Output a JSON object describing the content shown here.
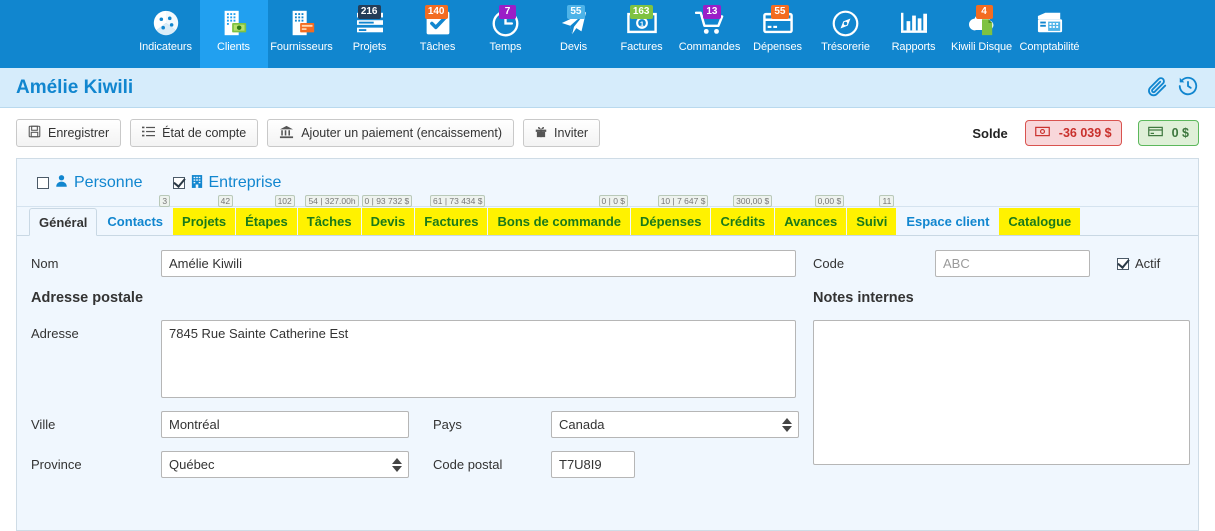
{
  "nav": {
    "items": [
      {
        "label": "Indicateurs",
        "icon": "dashboard-icon",
        "badge": null,
        "badge_color": null,
        "active": false
      },
      {
        "label": "Clients",
        "icon": "clients-icon",
        "badge": null,
        "badge_color": null,
        "active": true
      },
      {
        "label": "Fournisseurs",
        "icon": "suppliers-icon",
        "badge": null,
        "badge_color": null,
        "active": false
      },
      {
        "label": "Projets",
        "icon": "projects-icon",
        "badge": "216",
        "badge_color": "#243d58",
        "active": false
      },
      {
        "label": "Tâches",
        "icon": "tasks-icon",
        "badge": "140",
        "badge_color": "#f36c21",
        "active": false
      },
      {
        "label": "Temps",
        "icon": "time-icon",
        "badge": "7",
        "badge_color": "#9b1ec7",
        "active": false
      },
      {
        "label": "Devis",
        "icon": "quotes-icon",
        "badge": "55",
        "badge_color": "#4eb3e8",
        "active": false
      },
      {
        "label": "Factures",
        "icon": "invoices-icon",
        "badge": "163",
        "badge_color": "#7fc241",
        "active": false
      },
      {
        "label": "Commandes",
        "icon": "orders-icon",
        "badge": "13",
        "badge_color": "#9b1ec7",
        "active": false
      },
      {
        "label": "Dépenses",
        "icon": "expenses-icon",
        "badge": "55",
        "badge_color": "#f36c21",
        "active": false
      },
      {
        "label": "Trésorerie",
        "icon": "treasury-icon",
        "badge": null,
        "badge_color": null,
        "active": false
      },
      {
        "label": "Rapports",
        "icon": "reports-icon",
        "badge": null,
        "badge_color": null,
        "active": false
      },
      {
        "label": "Kiwili Disque",
        "icon": "cloud-disk-icon",
        "badge": "4",
        "badge_color": "#f36c21",
        "active": false
      },
      {
        "label": "Comptabilité",
        "icon": "accounting-icon",
        "badge": null,
        "badge_color": null,
        "active": false
      }
    ]
  },
  "titlebar": {
    "title": "Amélie Kiwili"
  },
  "toolbar": {
    "save_label": "Enregistrer",
    "statement_label": "État de compte",
    "payment_label": "Ajouter un paiement (encaissement)",
    "invite_label": "Inviter",
    "solde_label": "Solde",
    "solde_negative": "-36 039 $",
    "solde_positive": "0 $"
  },
  "type_row": {
    "personne_label": "Personne",
    "personne_checked": false,
    "entreprise_label": "Entreprise",
    "entreprise_checked": true
  },
  "tabs": [
    {
      "label": "Général",
      "badge": null,
      "style": "general"
    },
    {
      "label": "Contacts",
      "badge": "3",
      "style": "plain"
    },
    {
      "label": "Projets",
      "badge": "42",
      "style": "hl"
    },
    {
      "label": "Étapes",
      "badge": "102",
      "style": "hl"
    },
    {
      "label": "Tâches",
      "badge": "54 | 327.00h",
      "style": "hl"
    },
    {
      "label": "Devis",
      "badge": "0 | 93 732 $",
      "style": "hl"
    },
    {
      "label": "Factures",
      "badge": "61 | 73 434 $",
      "style": "hl"
    },
    {
      "label": "Bons de commande",
      "badge": "0 | 0 $",
      "style": "hl"
    },
    {
      "label": "Dépenses",
      "badge": "10 | 7 647 $",
      "style": "hl"
    },
    {
      "label": "Crédits",
      "badge": "300,00 $",
      "style": "hl"
    },
    {
      "label": "Avances",
      "badge": "0,00 $",
      "style": "hl"
    },
    {
      "label": "Suivi",
      "badge": "11",
      "style": "hl"
    },
    {
      "label": "Espace client",
      "badge": null,
      "style": "plain"
    },
    {
      "label": "Catalogue",
      "badge": null,
      "style": "hl"
    }
  ],
  "form": {
    "nom_label": "Nom",
    "nom_value": "Amélie Kiwili",
    "code_label": "Code",
    "code_value": "",
    "code_placeholder": "ABC",
    "actif_label": "Actif",
    "actif_checked": true,
    "adresse_postale_title": "Adresse postale",
    "notes_internes_title": "Notes internes",
    "adresse_label": "Adresse",
    "adresse_value": "7845 Rue Sainte Catherine Est",
    "notes_value": "",
    "ville_label": "Ville",
    "ville_value": "Montréal",
    "pays_label": "Pays",
    "pays_value": "Canada",
    "province_label": "Province",
    "province_value": "Québec",
    "code_postal_label": "Code postal",
    "code_postal_value": "T7U8I9"
  },
  "colors": {
    "nav_bg": "#1186CF",
    "nav_active": "#21A0F0",
    "title_bg": "#D6ECFB",
    "brand_blue": "#1186CF",
    "highlight_yellow": "#FFF200",
    "tab_green": "#1a7a1a",
    "panel_bg": "#F0F7FE"
  }
}
